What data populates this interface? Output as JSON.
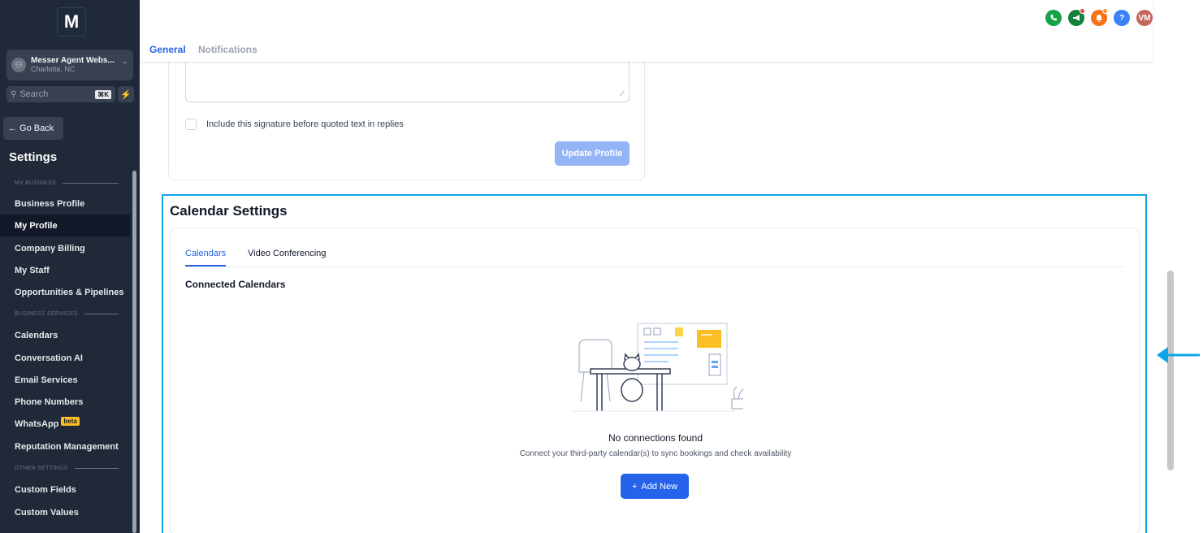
{
  "logo": {
    "letter": "M"
  },
  "account": {
    "name": "Messer Agent Webs...",
    "location": "Charlotte, NC"
  },
  "search": {
    "placeholder": "Search",
    "shortcut": "⌘K"
  },
  "go_back": "← Go Back",
  "settings_title": "Settings",
  "sidebar": {
    "sections": [
      {
        "header": "MY BUSINESS",
        "items": [
          "Business Profile",
          "My Profile",
          "Company Billing",
          "My Staff",
          "Opportunities & Pipelines"
        ]
      },
      {
        "header": "BUSINESS SERVICES",
        "items": [
          "Calendars",
          "Conversation AI",
          "Email Services",
          "Phone Numbers",
          "WhatsApp",
          "Reputation Management"
        ]
      },
      {
        "header": "OTHER SETTINGS",
        "items": [
          "Custom Fields",
          "Custom Values"
        ]
      }
    ],
    "active_item": "My Profile",
    "beta_badge": "beta"
  },
  "top_tabs": {
    "general": "General",
    "notifications": "Notifications"
  },
  "top_icons": [
    {
      "name": "phone-icon",
      "color": "#16a34a"
    },
    {
      "name": "megaphone-icon",
      "color": "#15803d"
    },
    {
      "name": "bell-icon",
      "color": "#f97316"
    },
    {
      "name": "help-icon",
      "color": "#3b82f6",
      "glyph": "?"
    },
    {
      "name": "user-avatar",
      "color": "#c2675a",
      "glyph": "VM"
    }
  ],
  "profile": {
    "signature_checkbox_label": "Include this signature before quoted text in replies",
    "update_button": "Update Profile"
  },
  "calendar_settings": {
    "title": "Calendar Settings",
    "tabs": {
      "calendars": "Calendars",
      "video": "Video Conferencing"
    },
    "connected_title": "Connected Calendars",
    "empty_title": "No connections found",
    "empty_desc": "Connect your third-party calendar(s) to sync bookings and check availability",
    "add_button": "Add New"
  }
}
